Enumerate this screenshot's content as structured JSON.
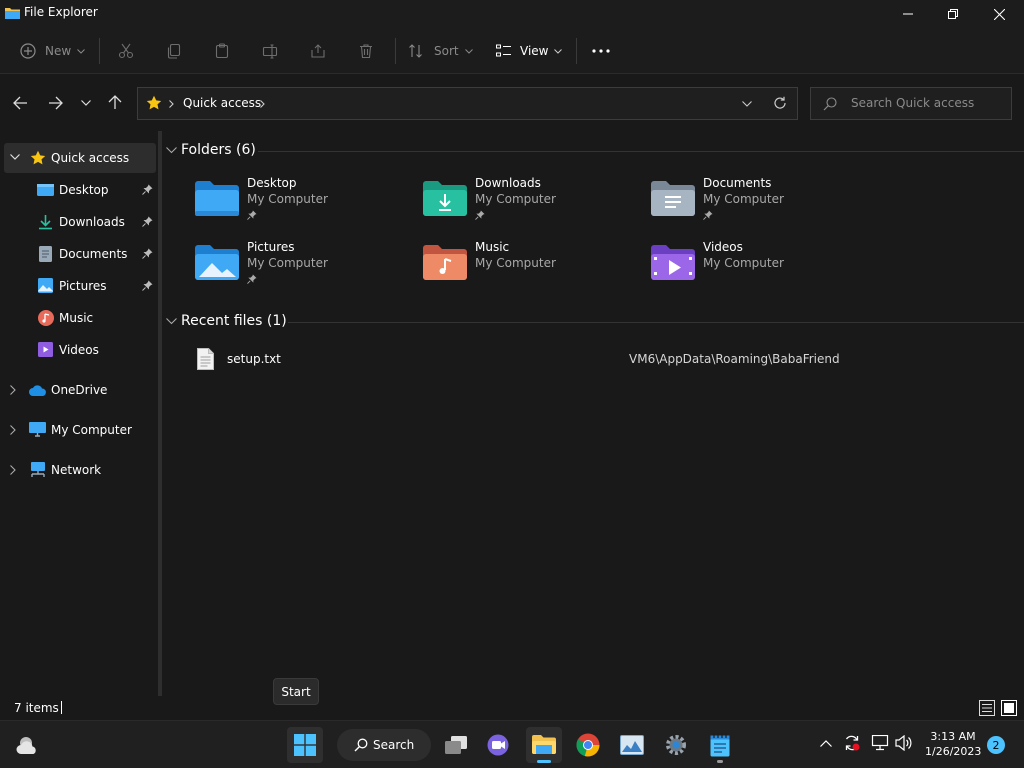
{
  "window": {
    "title": "File Explorer"
  },
  "toolbar": {
    "new_label": "New",
    "sort_label": "Sort",
    "view_label": "View"
  },
  "address": {
    "crumb": "Quick access",
    "search_placeholder": "Search Quick access"
  },
  "sidebar": {
    "quick_access": "Quick access",
    "items": [
      {
        "label": "Desktop"
      },
      {
        "label": "Downloads"
      },
      {
        "label": "Documents"
      },
      {
        "label": "Pictures"
      },
      {
        "label": "Music"
      },
      {
        "label": "Videos"
      }
    ],
    "onedrive": "OneDrive",
    "mycomputer": "My Computer",
    "network": "Network"
  },
  "main": {
    "folders_header": "Folders (6)",
    "folders": [
      {
        "name": "Desktop",
        "location": "My Computer"
      },
      {
        "name": "Downloads",
        "location": "My Computer"
      },
      {
        "name": "Documents",
        "location": "My Computer"
      },
      {
        "name": "Pictures",
        "location": "My Computer"
      },
      {
        "name": "Music",
        "location": "My Computer"
      },
      {
        "name": "Videos",
        "location": "My Computer"
      }
    ],
    "recent_header": "Recent files (1)",
    "recent": [
      {
        "name": "setup.txt",
        "path": "VM6\\AppData\\Roaming\\BabaFriend"
      }
    ]
  },
  "status": {
    "count": "7 items"
  },
  "tooltip": "Start",
  "taskbar": {
    "search_label": "Search",
    "time": "3:13 AM",
    "date": "1/26/2023",
    "notif_count": "2"
  },
  "colors": {
    "accent": "#4cc2ff",
    "folder_blue": "#3fa9f5",
    "star": "#f9c513",
    "selected_bg": "#2d2d2d"
  }
}
